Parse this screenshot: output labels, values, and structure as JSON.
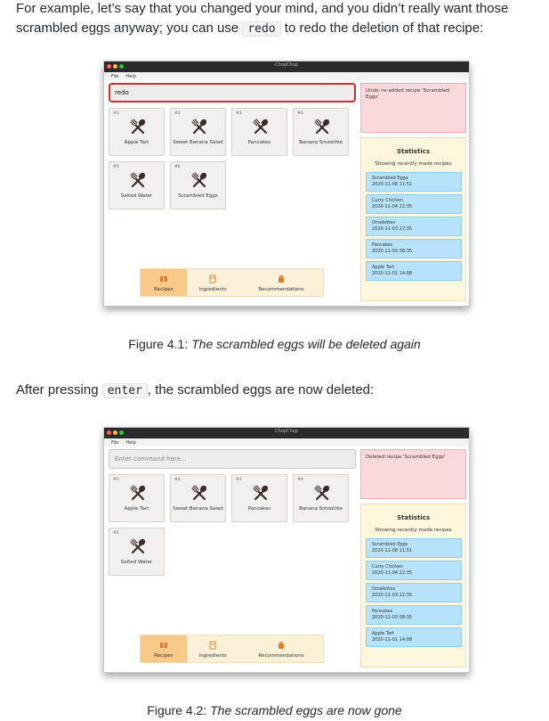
{
  "para1_line1": "For example, let’s say that you changed your mind, and you didn’t really want those",
  "para1_line2_pre": "scrambled eggs anyway; you can use",
  "para1_code": "redo",
  "para1_line2_post": "to redo the deletion of that recipe:",
  "fig1_caption_prefix": "Figure 4.1:",
  "fig1_caption_italic": "The scrambled eggs will be deleted again",
  "para2_pre": "After pressing",
  "para2_code": "enter",
  "para2_post": ", the scrambled eggs are now deleted:",
  "fig2_caption_prefix": "Figure 4.2:",
  "fig2_caption_italic": "The scrambled eggs are now gone",
  "app": {
    "window_title": "ChopChop",
    "menu": [
      "File",
      "Help"
    ],
    "tabs": [
      "Recipes",
      "Ingredients",
      "Recommendations"
    ],
    "stats_title": "Statistics",
    "stats_subtitle": "Showing recently made recipes",
    "stats_entries": [
      {
        "name": "Scrambled Eggs",
        "time": "2020-11-08 11:51"
      },
      {
        "name": "Curry Chicken",
        "time": "2020-11-04 22:35"
      },
      {
        "name": "Omelettes",
        "time": "2020-11-03 22:35"
      },
      {
        "name": "Pancakes",
        "time": "2020-11-03 08:35"
      },
      {
        "name": "Apple Tart",
        "time": "2020-11-01 14:08"
      }
    ]
  },
  "screen1": {
    "command_value": "redo",
    "response": "Undo: re-added recipe 'Scrambled Eggs'",
    "recipes": [
      {
        "num": "#1",
        "name": "Apple Tart"
      },
      {
        "num": "#2",
        "name": "Sweet Banana Salad"
      },
      {
        "num": "#3",
        "name": "Pancakes"
      },
      {
        "num": "#4",
        "name": "Banana Smoothie"
      },
      {
        "num": "#5",
        "name": "Salted Water"
      },
      {
        "num": "#6",
        "name": "Scrambled Eggs"
      }
    ]
  },
  "screen2": {
    "command_placeholder": "Enter command here...",
    "response": "Deleted recipe 'Scrambled Eggs'",
    "recipes": [
      {
        "num": "#1",
        "name": "Apple Tart"
      },
      {
        "num": "#2",
        "name": "Sweet Banana Salad"
      },
      {
        "num": "#3",
        "name": "Pancakes"
      },
      {
        "num": "#4",
        "name": "Banana Smoothie"
      },
      {
        "num": "#5",
        "name": "Salted Water"
      }
    ]
  },
  "colors": {
    "command_highlight": "#d92b2b",
    "active_tab": "#f9c98a",
    "response_bg": "#fbd8dc",
    "stats_bg": "#fff7dd",
    "stat_entry_bg": "#b7e2fb",
    "card_bg": "#f3efec"
  },
  "icons": {
    "recipe_card": "fork-spoon-icon",
    "tab_recipes": "book-icon",
    "tab_ingredients": "fridge-icon",
    "tab_recommendations": "jar-icon"
  }
}
